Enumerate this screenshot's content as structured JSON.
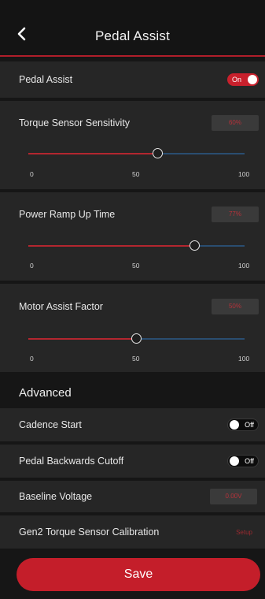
{
  "header": {
    "title": "Pedal Assist"
  },
  "pedal_assist": {
    "label": "Pedal Assist",
    "toggle_label": "On",
    "enabled": true
  },
  "sliders": [
    {
      "label": "Torque Sensor Sensitivity",
      "value_text": "60%",
      "value": 60,
      "min_label": "0",
      "mid_label": "50",
      "max_label": "100"
    },
    {
      "label": "Power Ramp Up Time",
      "value_text": "77%",
      "value": 77,
      "min_label": "0",
      "mid_label": "50",
      "max_label": "100"
    },
    {
      "label": "Motor Assist Factor",
      "value_text": "50%",
      "value": 50,
      "min_label": "0",
      "mid_label": "50",
      "max_label": "100"
    }
  ],
  "advanced": {
    "title": "Advanced",
    "cadence_start": {
      "label": "Cadence Start",
      "toggle_label": "Off",
      "enabled": false
    },
    "pedal_backwards_cutoff": {
      "label": "Pedal Backwards Cutoff",
      "toggle_label": "Off",
      "enabled": false
    },
    "baseline_voltage": {
      "label": "Baseline Voltage",
      "value_text": "0.00V"
    },
    "calibration": {
      "label": "Gen2 Torque Sensor Calibration",
      "action": "Setup"
    }
  },
  "save_label": "Save",
  "colors": {
    "accent": "#c41e2a",
    "track_fill": "#b3262f",
    "track_rest": "#2a4d70",
    "panel": "#262626",
    "background": "#161616"
  }
}
